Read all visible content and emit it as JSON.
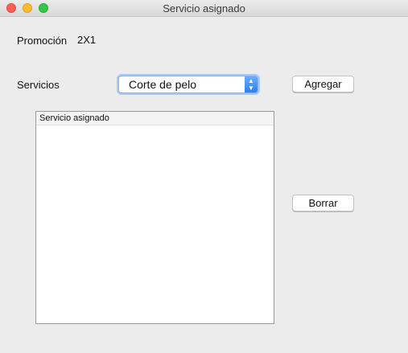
{
  "window": {
    "title": "Servicio asignado"
  },
  "promo": {
    "label": "Promoción",
    "value": "2X1"
  },
  "servicios": {
    "label": "Servicios",
    "selected": "Corte de pelo"
  },
  "buttons": {
    "add": "Agregar",
    "delete": "Borrar"
  },
  "list": {
    "header": "Servicio asignado",
    "rows": []
  }
}
